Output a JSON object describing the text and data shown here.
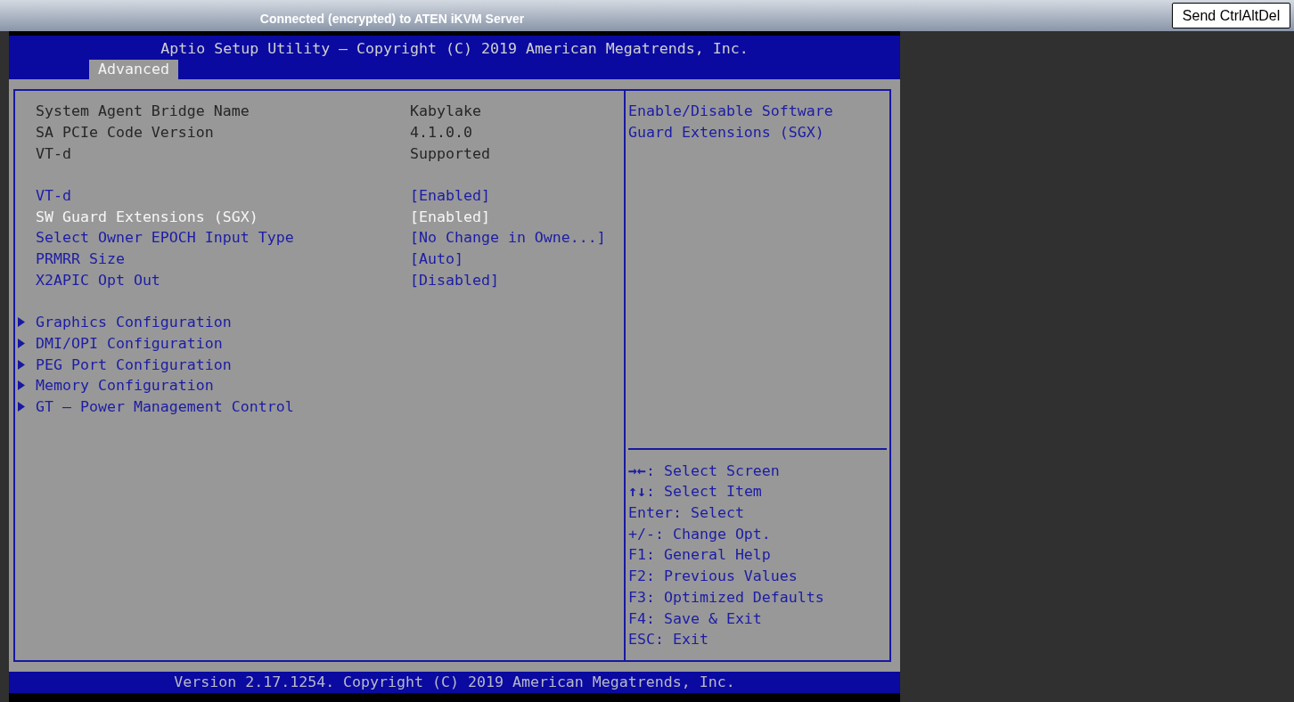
{
  "session_bar": {
    "title": "Connected (encrypted) to ATEN iKVM Server",
    "button": "Send CtrlAltDel"
  },
  "bios": {
    "title": "Aptio Setup Utility – Copyright (C) 2019 American Megatrends, Inc.",
    "tabs": [
      {
        "label": "Advanced",
        "selected": true
      }
    ],
    "groups": [
      {
        "items": [
          {
            "kind": "info",
            "label": "System Agent Bridge Name",
            "value": "Kabylake"
          },
          {
            "kind": "info",
            "label": "SA PCIe Code Version",
            "value": "4.1.0.0"
          },
          {
            "kind": "info",
            "label": "VT-d",
            "value": "Supported"
          }
        ]
      },
      {
        "items": [
          {
            "kind": "setting",
            "label": "VT-d",
            "value": "[Enabled]",
            "selected": false
          },
          {
            "kind": "setting",
            "label": "SW Guard Extensions (SGX)",
            "value": "[Enabled]",
            "selected": true
          },
          {
            "kind": "setting",
            "label": "Select Owner EPOCH Input Type",
            "value": "[No Change in Owne...]",
            "selected": false
          },
          {
            "kind": "setting",
            "label": "PRMRR Size",
            "value": "[Auto]",
            "selected": false
          },
          {
            "kind": "setting",
            "label": "X2APIC Opt Out",
            "value": "[Disabled]",
            "selected": false
          }
        ]
      },
      {
        "items": [
          {
            "kind": "submenu",
            "label": "Graphics Configuration",
            "selected": false
          },
          {
            "kind": "submenu",
            "label": "DMI/OPI Configuration",
            "selected": false
          },
          {
            "kind": "submenu",
            "label": "PEG Port Configuration",
            "selected": false
          },
          {
            "kind": "submenu",
            "label": "Memory Configuration",
            "selected": false
          },
          {
            "kind": "submenu",
            "label": "GT – Power Management Control",
            "selected": false
          }
        ]
      }
    ],
    "help_text": "Enable/Disable Software Guard Extensions (SGX)",
    "key_hints": [
      "**→←**: Select Screen",
      "**↑↓**: Select Item",
      "Enter: Select",
      "+/-: Change Opt.",
      "F1: General Help",
      "F2: Previous Values",
      "F3: Optimized Defaults",
      "F4: Save & Exit",
      "ESC: Exit"
    ],
    "footer": "Version 2.17.1254. Copyright (C) 2019 American Megatrends, Inc."
  }
}
